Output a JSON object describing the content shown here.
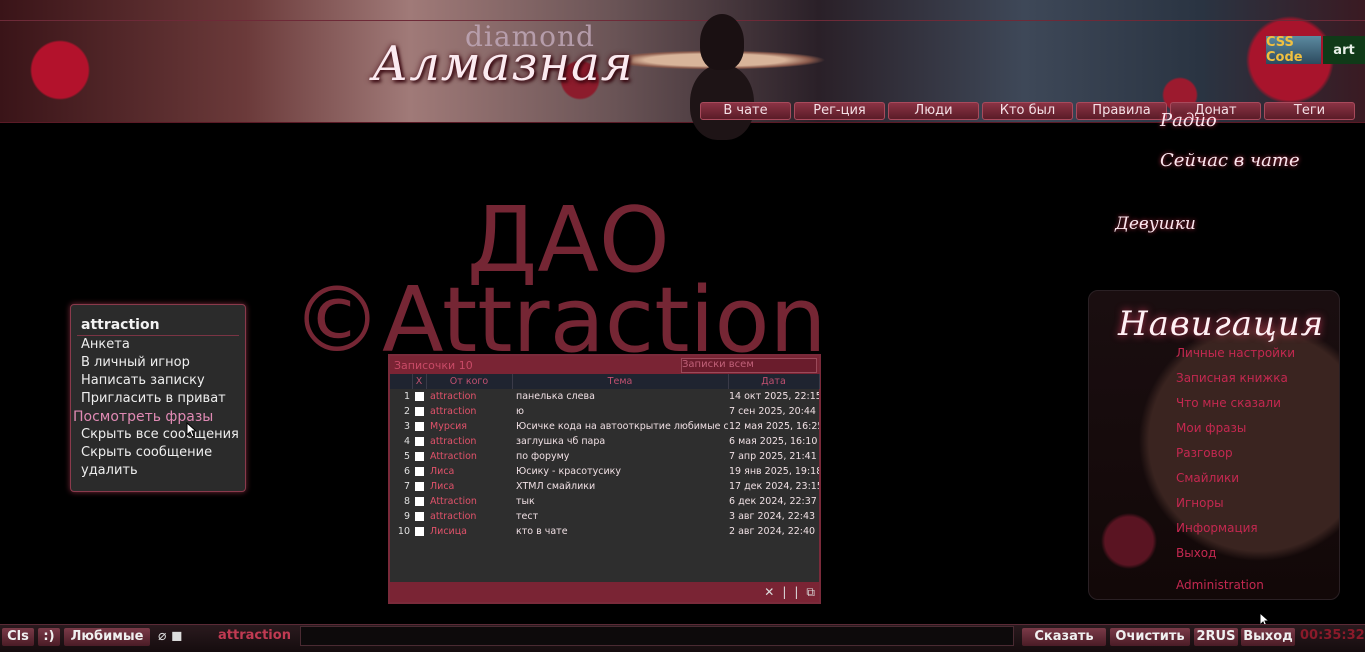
{
  "header": {
    "logo_top": "diamond",
    "logo_main": "Алмазная",
    "badge_css": "CSS Code",
    "badge_art": "art"
  },
  "nav_tabs": [
    "В чате",
    "Рег-ция",
    "Люди",
    "Кто был",
    "Правила",
    "Донат",
    "Теги"
  ],
  "watermark": {
    "line1": "ДАО",
    "line2": "©Attraction"
  },
  "context_menu": {
    "title": "attraction",
    "items": [
      "Анкета",
      "В личный игнор",
      "Написать записку",
      "Пригласить в приват",
      "Посмотреть фразы",
      "Скрыть все сообщения",
      "Скрыть сообщение",
      "удалить"
    ]
  },
  "messages": {
    "title": "Записочки 10",
    "filter_value": "Записки всем",
    "headers": {
      "x": "X",
      "from": "От кого",
      "subject": "Тема",
      "date": "Дата"
    },
    "rows": [
      {
        "num": "1",
        "from": "attraction",
        "subject": "панелька слева",
        "date": "14 окт 2025, 22:15"
      },
      {
        "num": "2",
        "from": "attraction",
        "subject": "ю",
        "date": "7 сен 2025, 20:44"
      },
      {
        "num": "3",
        "from": "Мурсия",
        "subject": "Юсичке кода на автооткрытие любимые смай",
        "date": "12 мая 2025, 16:25"
      },
      {
        "num": "4",
        "from": "attraction",
        "subject": "заглушка чб пара",
        "date": "6 мая 2025, 16:10"
      },
      {
        "num": "5",
        "from": "Attraction",
        "subject": "по форуму",
        "date": "7 апр 2025, 21:41"
      },
      {
        "num": "6",
        "from": "Лиса",
        "subject": "Юсику - красотусику",
        "date": "19 янв 2025, 19:18"
      },
      {
        "num": "7",
        "from": "Лиса",
        "subject": "ХТМЛ смайлики",
        "date": "17 дек 2024, 23:15"
      },
      {
        "num": "8",
        "from": "Attraction",
        "subject": "тык",
        "date": "6 дек 2024, 22:37"
      },
      {
        "num": "9",
        "from": "attraction",
        "subject": "тест",
        "date": "3 авг 2024, 22:43"
      },
      {
        "num": "10",
        "from": "Лисица",
        "subject": "кто в чате",
        "date": "2 авг 2024, 22:40"
      }
    ],
    "footer_icons": [
      "✕",
      "|",
      "|",
      "⧉"
    ]
  },
  "side": {
    "title1": "Радио",
    "title2": "Сейчас в чате",
    "title3": "Девушки",
    "nav_title": "Навигация",
    "links": [
      "Личные настройки",
      "Записная книжка",
      "Что мне сказали",
      "Мои фразы",
      "Разговор",
      "Смайлики",
      "Игноры",
      "Информация",
      "Выход",
      "Administration"
    ]
  },
  "bottom": {
    "cls": "Cls",
    "smile": ":)",
    "fav": "Любимые",
    "nick": "attraction",
    "say": "Сказать",
    "clear": "Очистить",
    "lang": "2RUS",
    "exit": "Выход",
    "clock": "00:35:32"
  }
}
